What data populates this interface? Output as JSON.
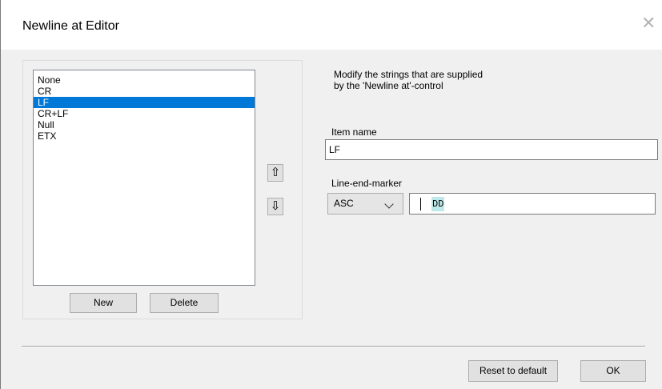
{
  "window": {
    "title": "Newline at Editor",
    "close_glyph": "✕"
  },
  "list": {
    "items": [
      "None",
      "CR",
      "LF",
      "CR+LF",
      "Null",
      "ETX"
    ],
    "selected_index": 2
  },
  "buttons": {
    "new_label": "New",
    "delete_label": "Delete",
    "up_glyph": "⇧",
    "down_glyph": "⇩",
    "reset_label": "Reset to default",
    "ok_label": "OK"
  },
  "info": {
    "line1": "Modify the strings that are supplied",
    "line2": "by the 'Newline at'-control"
  },
  "item_name": {
    "label": "Item name",
    "value": "LF"
  },
  "line_end": {
    "label": "Line-end-marker",
    "mode_value": "ASC",
    "value": "DD"
  },
  "colors": {
    "selection": "#0078d7",
    "dialog_bg": "#f0f0f0",
    "highlight": "#bfe9e9"
  }
}
